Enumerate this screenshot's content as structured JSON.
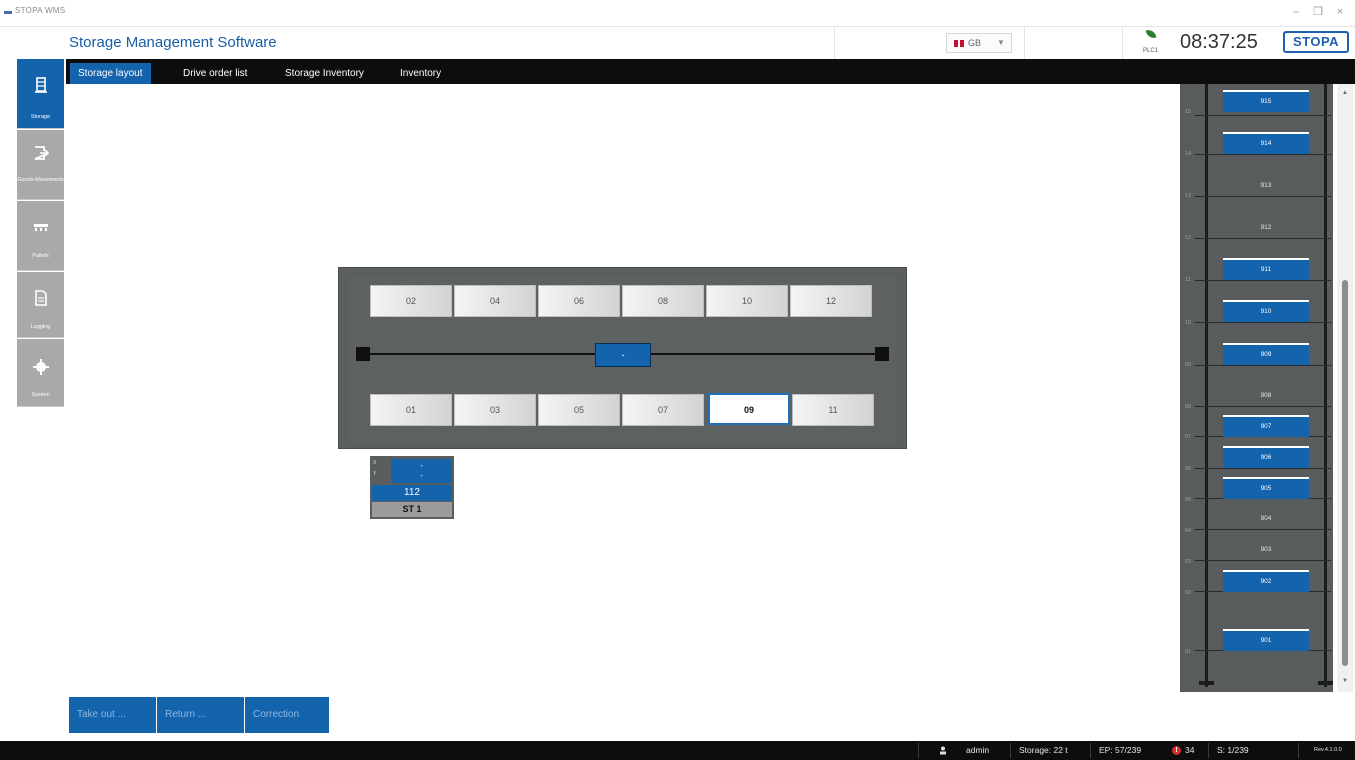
{
  "window": {
    "title": "STOPA WMS",
    "controls": [
      "–",
      "❐",
      "×"
    ]
  },
  "header": {
    "app_title": "Storage Management Software",
    "language": "GB",
    "plc_label": "PLC1",
    "clock": "08:37:25",
    "logo_text": "STOPA"
  },
  "sidebar": {
    "items": [
      {
        "label": "Storage",
        "icon": "storage-rack-icon",
        "active": true
      },
      {
        "label": "Goods-Movements",
        "icon": "exit-arrow-icon",
        "active": false
      },
      {
        "label": "Pallets",
        "icon": "pallet-icon",
        "active": false
      },
      {
        "label": "Logging",
        "icon": "document-icon",
        "active": false
      },
      {
        "label": "System",
        "icon": "gear-icon",
        "active": false
      }
    ]
  },
  "tabs": [
    {
      "label": "Storage layout",
      "active": true
    },
    {
      "label": "Drive order list",
      "active": false
    },
    {
      "label": "Storage Inventory",
      "active": false
    },
    {
      "label": "Inventory",
      "active": false
    }
  ],
  "lift": {
    "top_row": [
      "02",
      "04",
      "06",
      "08",
      "10",
      "12"
    ],
    "bottom_row": [
      "01",
      "03",
      "05",
      "07",
      "09",
      "11"
    ],
    "selected": "09",
    "carriage_label": "-"
  },
  "station": {
    "mini_a": "X",
    "mini_b": "Y",
    "top_line1": "-",
    "top_line2": "-",
    "number": "112",
    "name": "ST 1"
  },
  "shelf": {
    "rows": [
      "15",
      "14",
      "13",
      "12",
      "11",
      "10",
      "09",
      "08",
      "07",
      "06",
      "05",
      "04",
      "03",
      "02",
      "01"
    ],
    "slots": [
      {
        "label": "915",
        "occupied": true
      },
      {
        "label": "914",
        "occupied": true
      },
      {
        "label": "913",
        "occupied": false
      },
      {
        "label": "912",
        "occupied": false
      },
      {
        "label": "911",
        "occupied": true
      },
      {
        "label": "910",
        "occupied": true
      },
      {
        "label": "909",
        "occupied": true
      },
      {
        "label": "908",
        "occupied": false
      },
      {
        "label": "907",
        "occupied": true
      },
      {
        "label": "906",
        "occupied": true
      },
      {
        "label": "905",
        "occupied": true
      },
      {
        "label": "904",
        "occupied": false
      },
      {
        "label": "903",
        "occupied": false
      },
      {
        "label": "902",
        "occupied": true
      },
      {
        "label": "901",
        "occupied": true
      }
    ]
  },
  "actions": {
    "take_out": "Take out ...",
    "return": "Return ...",
    "correction": "Correction"
  },
  "status": {
    "user": "admin",
    "storage": "Storage: 22 t",
    "ep": "EP: 57/239",
    "errors": "34",
    "s": "S: 1/239",
    "version": "Rev.4.1.0.0"
  },
  "colors": {
    "accent": "#1463ad",
    "dark": "#0d0d0d",
    "shelf_bg": "#585c5d",
    "error": "#d32f2f"
  }
}
